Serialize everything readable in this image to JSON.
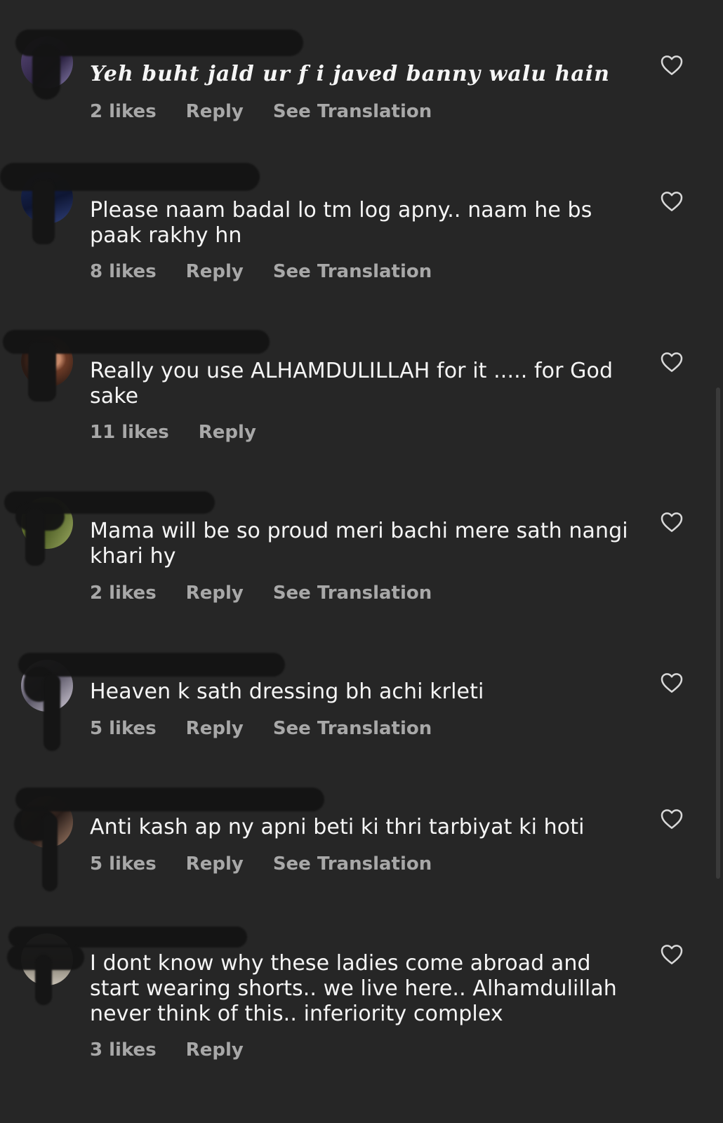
{
  "comments": [
    {
      "text": "Yeh buht  jald ur f i  javed banny walu hain",
      "likes": "2 likes",
      "reply": "Reply",
      "translation": "See Translation"
    },
    {
      "text": "Please naam badal lo tm log apny.. naam he bs paak rakhy hn",
      "likes": "8 likes",
      "reply": "Reply",
      "translation": "See Translation"
    },
    {
      "text": "Really you use ALHAMDULILLAH for it ..... for God sake",
      "likes": "11 likes",
      "reply": "Reply"
    },
    {
      "text": "Mama will be so proud meri bachi mere sath nangi khari hy",
      "likes": "2 likes",
      "reply": "Reply",
      "translation": "See Translation"
    },
    {
      "text": "Heaven k sath dressing bh achi krleti",
      "likes": "5 likes",
      "reply": "Reply",
      "translation": "See Translation"
    },
    {
      "text": "Anti kash ap ny apni beti ki thri tarbiyat ki hoti",
      "likes": "5 likes",
      "reply": "Reply",
      "translation": "See Translation"
    },
    {
      "text": "I dont know why these ladies come abroad and start wearing shorts.. we live here.. Alhamdulillah never think of this.. inferiority  complex",
      "likes": "3 likes",
      "reply": "Reply"
    }
  ],
  "icons": {
    "like": "heart-outline-icon"
  },
  "colors": {
    "background": "#262626",
    "text": "#f5f5f5",
    "secondary": "#a8a8a8"
  }
}
